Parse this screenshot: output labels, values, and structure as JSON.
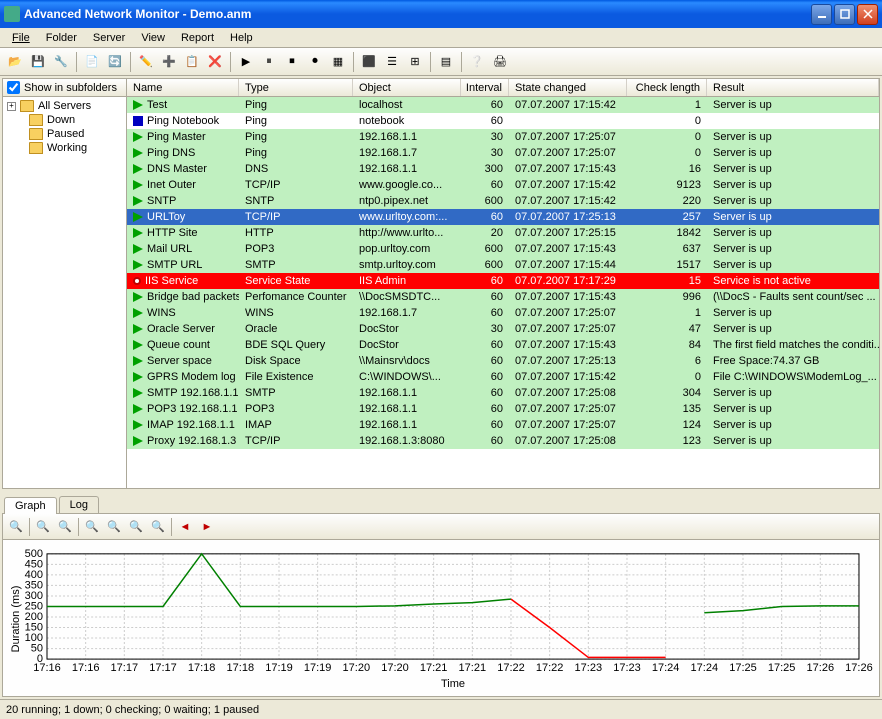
{
  "window": {
    "title": "Advanced Network Monitor - Demo.anm"
  },
  "menu": {
    "items": [
      "File",
      "Folder",
      "Server",
      "View",
      "Report",
      "Help"
    ]
  },
  "sidebar": {
    "checkbox_label": "Show in subfolders",
    "root": "All Servers",
    "children": [
      "Down",
      "Paused",
      "Working"
    ]
  },
  "grid": {
    "headers": [
      "Name",
      "Type",
      "Object",
      "Interval",
      "State changed",
      "Check length",
      "Result"
    ],
    "rows": [
      {
        "status": "up",
        "name": "Test",
        "type": "Ping",
        "object": "localhost",
        "interval": "60",
        "state": "07.07.2007 17:15:42",
        "check": "1",
        "result": "Server is up",
        "style": "green"
      },
      {
        "status": "paused",
        "name": "Ping Notebook",
        "type": "Ping",
        "object": "notebook",
        "interval": "60",
        "state": "",
        "check": "0",
        "result": "",
        "style": "white"
      },
      {
        "status": "up",
        "name": "Ping Master",
        "type": "Ping",
        "object": "192.168.1.1",
        "interval": "30",
        "state": "07.07.2007 17:25:07",
        "check": "0",
        "result": "Server is up",
        "style": "green"
      },
      {
        "status": "up",
        "name": "Ping DNS",
        "type": "Ping",
        "object": "192.168.1.7",
        "interval": "30",
        "state": "07.07.2007 17:25:07",
        "check": "0",
        "result": "Server is up",
        "style": "green"
      },
      {
        "status": "up",
        "name": "DNS Master",
        "type": "DNS",
        "object": "192.168.1.1",
        "interval": "300",
        "state": "07.07.2007 17:15:43",
        "check": "16",
        "result": "Server is up",
        "style": "green"
      },
      {
        "status": "up",
        "name": "Inet Outer",
        "type": "TCP/IP",
        "object": "www.google.co...",
        "interval": "60",
        "state": "07.07.2007 17:15:42",
        "check": "9123",
        "result": "Server is up",
        "style": "green"
      },
      {
        "status": "up",
        "name": "SNTP",
        "type": "SNTP",
        "object": "ntp0.pipex.net",
        "interval": "600",
        "state": "07.07.2007 17:15:42",
        "check": "220",
        "result": "Server is up",
        "style": "green"
      },
      {
        "status": "up",
        "name": "URLToy",
        "type": "TCP/IP",
        "object": "www.urltoy.com:...",
        "interval": "60",
        "state": "07.07.2007 17:25:13",
        "check": "257",
        "result": "Server is up",
        "style": "selected"
      },
      {
        "status": "up",
        "name": "HTTP Site",
        "type": "HTTP",
        "object": "http://www.urlto...",
        "interval": "20",
        "state": "07.07.2007 17:25:15",
        "check": "1842",
        "result": "Server is up",
        "style": "green"
      },
      {
        "status": "up",
        "name": "Mail URL",
        "type": "POP3",
        "object": "pop.urltoy.com",
        "interval": "600",
        "state": "07.07.2007 17:15:43",
        "check": "637",
        "result": "Server is up",
        "style": "green"
      },
      {
        "status": "up",
        "name": "SMTP URL",
        "type": "SMTP",
        "object": "smtp.urltoy.com",
        "interval": "600",
        "state": "07.07.2007 17:15:44",
        "check": "1517",
        "result": "Server is up",
        "style": "green"
      },
      {
        "status": "down",
        "name": "IIS Service",
        "type": "Service State",
        "object": "IIS Admin",
        "interval": "60",
        "state": "07.07.2007 17:17:29",
        "check": "15",
        "result": "Service is not active",
        "style": "red"
      },
      {
        "status": "up",
        "name": "Bridge bad packets",
        "type": "Perfomance Counter",
        "object": "\\\\DocSMSDTC...",
        "interval": "60",
        "state": "07.07.2007 17:15:43",
        "check": "996",
        "result": "(\\\\DocS - Faults sent count/sec ...",
        "style": "green"
      },
      {
        "status": "up",
        "name": "WINS",
        "type": "WINS",
        "object": "192.168.1.7",
        "interval": "60",
        "state": "07.07.2007 17:25:07",
        "check": "1",
        "result": "Server is up",
        "style": "green"
      },
      {
        "status": "up",
        "name": "Oracle Server",
        "type": "Oracle",
        "object": "DocStor",
        "interval": "30",
        "state": "07.07.2007 17:25:07",
        "check": "47",
        "result": "Server is up",
        "style": "green"
      },
      {
        "status": "up",
        "name": "Queue count",
        "type": "BDE SQL Query",
        "object": "DocStor",
        "interval": "60",
        "state": "07.07.2007 17:15:43",
        "check": "84",
        "result": "The first field matches the conditi...",
        "style": "green"
      },
      {
        "status": "up",
        "name": "Server space",
        "type": "Disk Space",
        "object": "\\\\Mainsrv\\docs",
        "interval": "60",
        "state": "07.07.2007 17:25:13",
        "check": "6",
        "result": "Free Space:74.37 GB",
        "style": "green"
      },
      {
        "status": "up",
        "name": "GPRS Modem log",
        "type": "File Existence",
        "object": "C:\\WINDOWS\\...",
        "interval": "60",
        "state": "07.07.2007 17:15:42",
        "check": "0",
        "result": "File C:\\WINDOWS\\ModemLog_...",
        "style": "green"
      },
      {
        "status": "up",
        "name": "SMTP 192.168.1.1",
        "type": "SMTP",
        "object": "192.168.1.1",
        "interval": "60",
        "state": "07.07.2007 17:25:08",
        "check": "304",
        "result": "Server is up",
        "style": "green"
      },
      {
        "status": "up",
        "name": "POP3 192.168.1.1",
        "type": "POP3",
        "object": "192.168.1.1",
        "interval": "60",
        "state": "07.07.2007 17:25:07",
        "check": "135",
        "result": "Server is up",
        "style": "green"
      },
      {
        "status": "up",
        "name": "IMAP 192.168.1.1",
        "type": "IMAP",
        "object": "192.168.1.1",
        "interval": "60",
        "state": "07.07.2007 17:25:07",
        "check": "124",
        "result": "Server is up",
        "style": "green"
      },
      {
        "status": "up",
        "name": "Proxy 192.168.1.3",
        "type": "TCP/IP",
        "object": "192.168.1.3:8080",
        "interval": "60",
        "state": "07.07.2007 17:25:08",
        "check": "123",
        "result": "Server is up",
        "style": "green"
      }
    ]
  },
  "tabs": {
    "items": [
      "Graph",
      "Log"
    ],
    "active": 0
  },
  "chart_data": {
    "type": "line",
    "title": "",
    "xlabel": "Time",
    "ylabel": "Duration (ms)",
    "ylim": [
      0,
      500
    ],
    "x_ticks": [
      "17:16",
      "17:16",
      "17:17",
      "17:17",
      "17:18",
      "17:18",
      "17:19",
      "17:19",
      "17:20",
      "17:20",
      "17:21",
      "17:21",
      "17:22",
      "17:22",
      "17:23",
      "17:23",
      "17:24",
      "17:24",
      "17:25",
      "17:25",
      "17:26",
      "17:26"
    ],
    "y_ticks": [
      0,
      50,
      100,
      150,
      200,
      250,
      300,
      350,
      400,
      450,
      500
    ],
    "series": [
      {
        "name": "green",
        "color": "#008000",
        "values": [
          250,
          250,
          250,
          250,
          520,
          250,
          250,
          250,
          250,
          253,
          262,
          268,
          285,
          null,
          null,
          null,
          null,
          220,
          230,
          250,
          253,
          253
        ]
      },
      {
        "name": "red",
        "color": "#ff0000",
        "values": [
          null,
          null,
          null,
          null,
          null,
          null,
          null,
          null,
          null,
          null,
          null,
          null,
          285,
          150,
          8,
          8,
          8,
          null,
          null,
          null,
          null,
          null
        ]
      }
    ]
  },
  "statusbar": {
    "text": "20 running; 1 down; 0 checking; 0 waiting; 1 paused"
  }
}
